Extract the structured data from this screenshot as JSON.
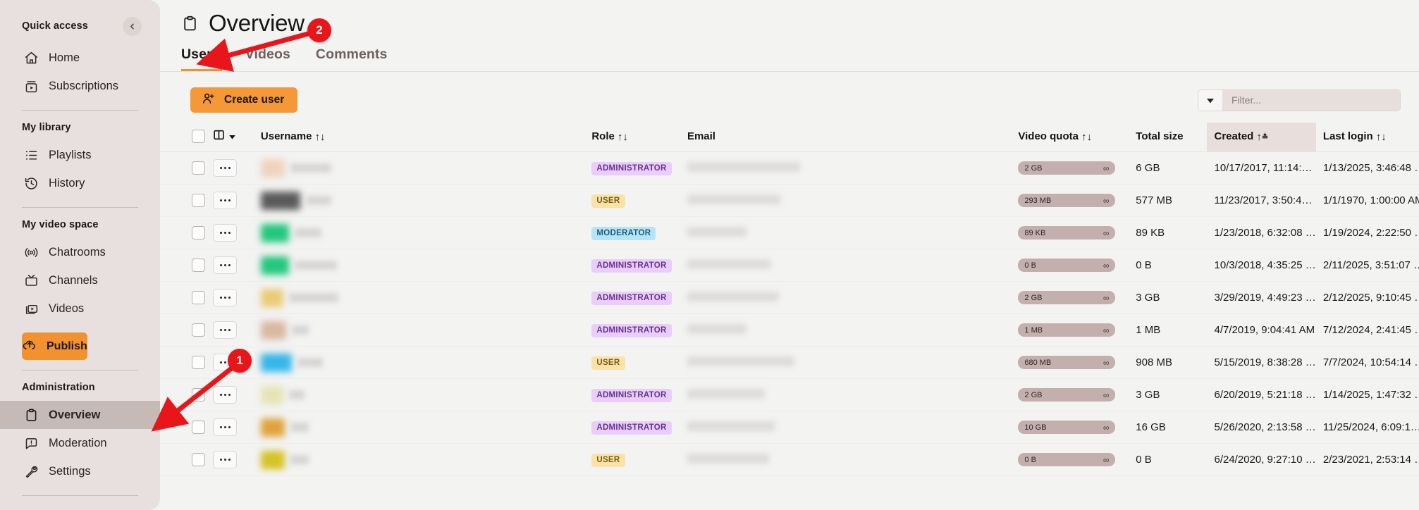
{
  "sidebar": {
    "quick_access": {
      "label": "Quick access",
      "collapse_icon": "chevron-left-icon",
      "items": [
        {
          "label": "Home",
          "icon": "home-icon"
        },
        {
          "label": "Subscriptions",
          "icon": "subscriptions-icon"
        }
      ]
    },
    "my_library": {
      "label": "My library",
      "items": [
        {
          "label": "Playlists",
          "icon": "playlist-icon"
        },
        {
          "label": "History",
          "icon": "history-icon"
        }
      ]
    },
    "my_video_space": {
      "label": "My video space",
      "items": [
        {
          "label": "Chatrooms",
          "icon": "broadcast-icon"
        },
        {
          "label": "Channels",
          "icon": "tv-icon"
        },
        {
          "label": "Videos",
          "icon": "video-stack-icon"
        }
      ],
      "publish_label": "Publish",
      "publish_icon": "upload-cloud-icon",
      "publish_color": "#f2922f"
    },
    "administration": {
      "label": "Administration",
      "items": [
        {
          "label": "Overview",
          "icon": "clipboard-icon",
          "active": true
        },
        {
          "label": "Moderation",
          "icon": "comment-alert-icon",
          "active": false
        },
        {
          "label": "Settings",
          "icon": "wrench-icon",
          "active": false
        }
      ]
    }
  },
  "header": {
    "title": "Overview",
    "title_icon": "clipboard-icon",
    "tabs": [
      {
        "label": "Users",
        "active": true
      },
      {
        "label": "Videos",
        "active": false
      },
      {
        "label": "Comments",
        "active": false
      }
    ]
  },
  "toolbar": {
    "create_user_label": "Create user",
    "create_user_icon": "user-plus-icon",
    "create_user_color": "#f49838",
    "filter_placeholder": "Filter...",
    "filter_value": "",
    "filter_dropdown_icon": "caret-down-icon"
  },
  "table": {
    "columns": [
      {
        "key": "check",
        "label": "",
        "sortable": false,
        "sorted": false
      },
      {
        "key": "menu",
        "label": "",
        "sortable": false,
        "sorted": false,
        "icon": "columns-icon"
      },
      {
        "key": "username",
        "label": "Username",
        "sortable": true,
        "sorted": false
      },
      {
        "key": "role",
        "label": "Role",
        "sortable": true,
        "sorted": false
      },
      {
        "key": "email",
        "label": "Email",
        "sortable": false,
        "sorted": false
      },
      {
        "key": "quota",
        "label": "Video quota",
        "sortable": true,
        "sorted": false
      },
      {
        "key": "size",
        "label": "Total size",
        "sortable": false,
        "sorted": false
      },
      {
        "key": "created",
        "label": "Created",
        "sortable": true,
        "sorted": true
      },
      {
        "key": "login",
        "label": "Last login",
        "sortable": true,
        "sorted": false
      }
    ],
    "sort_asc_desc_glyph": "↑↓",
    "sorted_glyph": "↑",
    "infinity_glyph": "∞",
    "rows": [
      {
        "avatar_color": "#f0d3bd",
        "avatar_w": 34,
        "name_w": 58,
        "email_w": 160,
        "role": "ADMINISTRATOR",
        "quota": "2 GB",
        "size": "6 GB",
        "created": "10/17/2017, 11:14:…",
        "last_login": "1/13/2025, 3:46:48 …"
      },
      {
        "avatar_color": "#5a5a5a",
        "avatar_w": 56,
        "name_w": 36,
        "email_w": 132,
        "role": "USER",
        "quota": "293 MB",
        "size": "577 MB",
        "created": "11/23/2017, 3:50:4…",
        "last_login": "1/1/1970, 1:00:00 AM"
      },
      {
        "avatar_color": "#22c77d",
        "avatar_w": 40,
        "name_w": 38,
        "email_w": 84,
        "role": "MODERATOR",
        "quota": "89 KB",
        "size": "89 KB",
        "created": "1/23/2018, 6:32:08 …",
        "last_login": "1/19/2024, 2:22:50 …"
      },
      {
        "avatar_color": "#22c77d",
        "avatar_w": 40,
        "name_w": 60,
        "email_w": 118,
        "role": "ADMINISTRATOR",
        "quota": "0 B",
        "size": "0 B",
        "created": "10/3/2018, 4:35:25 …",
        "last_login": "2/11/2025, 3:51:07 …"
      },
      {
        "avatar_color": "#eacb76",
        "avatar_w": 32,
        "name_w": 70,
        "email_w": 130,
        "role": "ADMINISTRATOR",
        "quota": "2 GB",
        "size": "3 GB",
        "created": "3/29/2019, 4:49:23 …",
        "last_login": "2/12/2025, 9:10:45 …"
      },
      {
        "avatar_color": "#d8b8a0",
        "avatar_w": 36,
        "name_w": 24,
        "email_w": 84,
        "role": "ADMINISTRATOR",
        "quota": "1 MB",
        "size": "1 MB",
        "created": "4/7/2019, 9:04:41 AM",
        "last_login": "7/12/2024, 2:41:45 …"
      },
      {
        "avatar_color": "#35b6ea",
        "avatar_w": 44,
        "name_w": 36,
        "email_w": 152,
        "role": "USER",
        "quota": "680 MB",
        "size": "908 MB",
        "created": "5/15/2019, 8:38:28 …",
        "last_login": "7/7/2024, 10:54:14 …"
      },
      {
        "avatar_color": "#e6e3b6",
        "avatar_w": 32,
        "name_w": 22,
        "email_w": 110,
        "role": "ADMINISTRATOR",
        "quota": "2 GB",
        "size": "3 GB",
        "created": "6/20/2019, 5:21:18 …",
        "last_login": "1/14/2025, 1:47:32 …"
      },
      {
        "avatar_color": "#e0a23a",
        "avatar_w": 34,
        "name_w": 26,
        "email_w": 124,
        "role": "ADMINISTRATOR",
        "quota": "10 GB",
        "size": "16 GB",
        "created": "5/26/2020, 2:13:58 …",
        "last_login": "11/25/2024, 6:09:1…"
      },
      {
        "avatar_color": "#d6c222",
        "avatar_w": 34,
        "name_w": 26,
        "email_w": 116,
        "role": "USER",
        "quota": "0 B",
        "size": "0 B",
        "created": "6/24/2020, 9:27:10 …",
        "last_login": "2/23/2021, 2:53:14 …"
      }
    ]
  },
  "annotations": {
    "color": "#e8161b",
    "markers": [
      {
        "number": "1",
        "target": "sidebar-item-overview"
      },
      {
        "number": "2",
        "target": "tab-users"
      }
    ]
  }
}
